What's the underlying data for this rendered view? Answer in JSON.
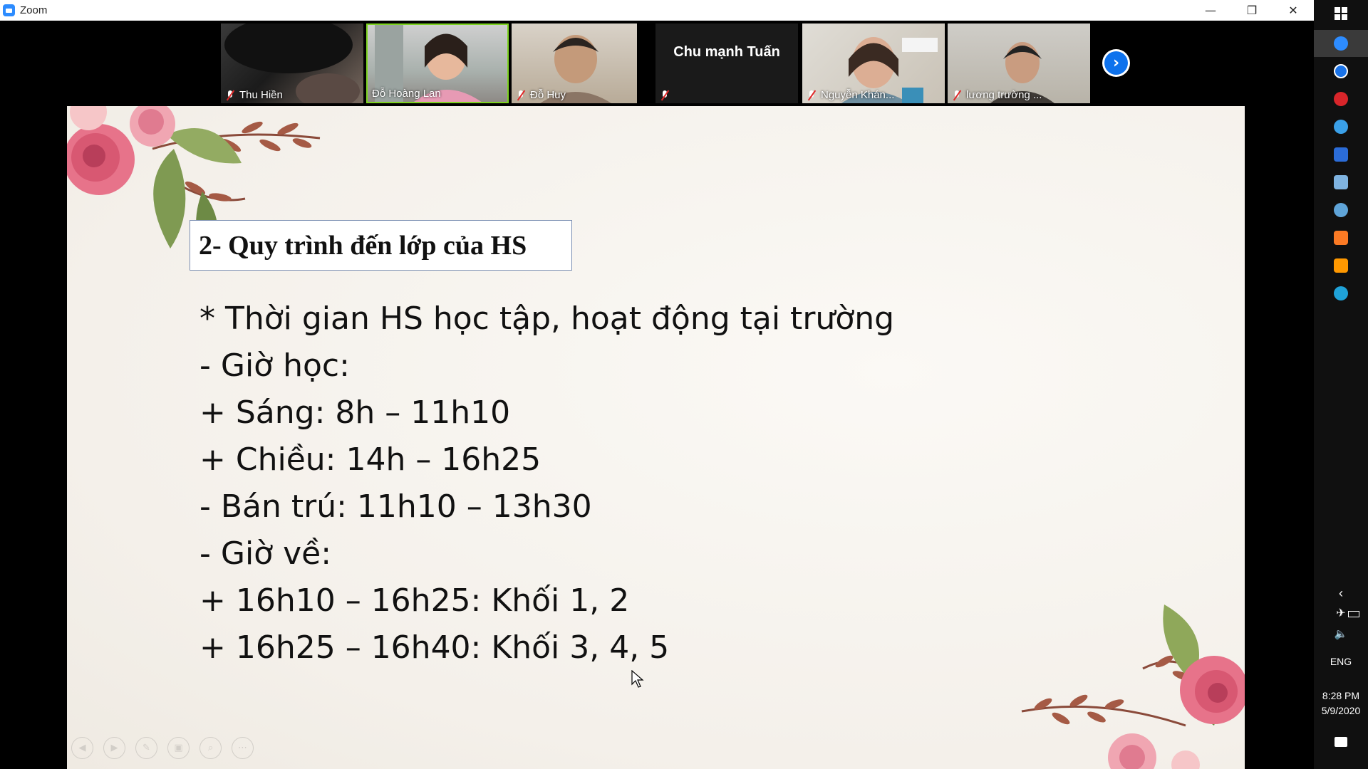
{
  "window": {
    "title": "Zoom",
    "controls": {
      "minimize": "—",
      "restore": "❐",
      "close": "✕"
    }
  },
  "participants": [
    {
      "name": "Thu Hiền",
      "muted": true,
      "video": true
    },
    {
      "name": "Đỗ Hoàng Lan",
      "muted": false,
      "video": true,
      "speaking": true
    },
    {
      "name": "Đỗ Huy",
      "muted": true,
      "video": true
    },
    {
      "name": "Chu mạnh Tuấn",
      "muted": true,
      "video": false
    },
    {
      "name": "Nguyễn Khán...",
      "muted": true,
      "video": true
    },
    {
      "name": "lương trường ...",
      "muted": true,
      "video": true
    }
  ],
  "strip": {
    "next_icon": "chevron-right-icon",
    "next_label": "›"
  },
  "slide": {
    "title": "2- Quy trình đến lớp của HS",
    "lines": [
      "* Thời gian HS học tập, hoạt động tại trường",
      "- Giờ học:",
      "+ Sáng: 8h – 11h10",
      "+ Chiều: 14h – 16h25",
      "- Bán trú: 11h10 – 13h30",
      "- Giờ về:",
      "+ 16h10 – 16h25: Khối 1, 2",
      "+ 16h25 – 16h40: Khối 3, 4, 5"
    ],
    "tools": [
      "previous-icon",
      "next-icon",
      "pen-icon",
      "slides-icon",
      "zoom-icon",
      "more-icon"
    ]
  },
  "taskbar": {
    "apps": [
      "windows-start-icon",
      "zoom-app-icon",
      "zalo-icon",
      "screen-recorder-icon",
      "navigation-icon",
      "window-app-icon",
      "photos-icon",
      "settings-icon",
      "xampp-icon",
      "sublime-icon",
      "edge-icon"
    ],
    "tray": {
      "language": "ENG",
      "time": "8:28 PM",
      "date": "5/9/2020"
    }
  },
  "colors": {
    "zoom_blue": "#2d8cff",
    "active_speaker": "#7ed321",
    "muted_red": "#e02828"
  }
}
